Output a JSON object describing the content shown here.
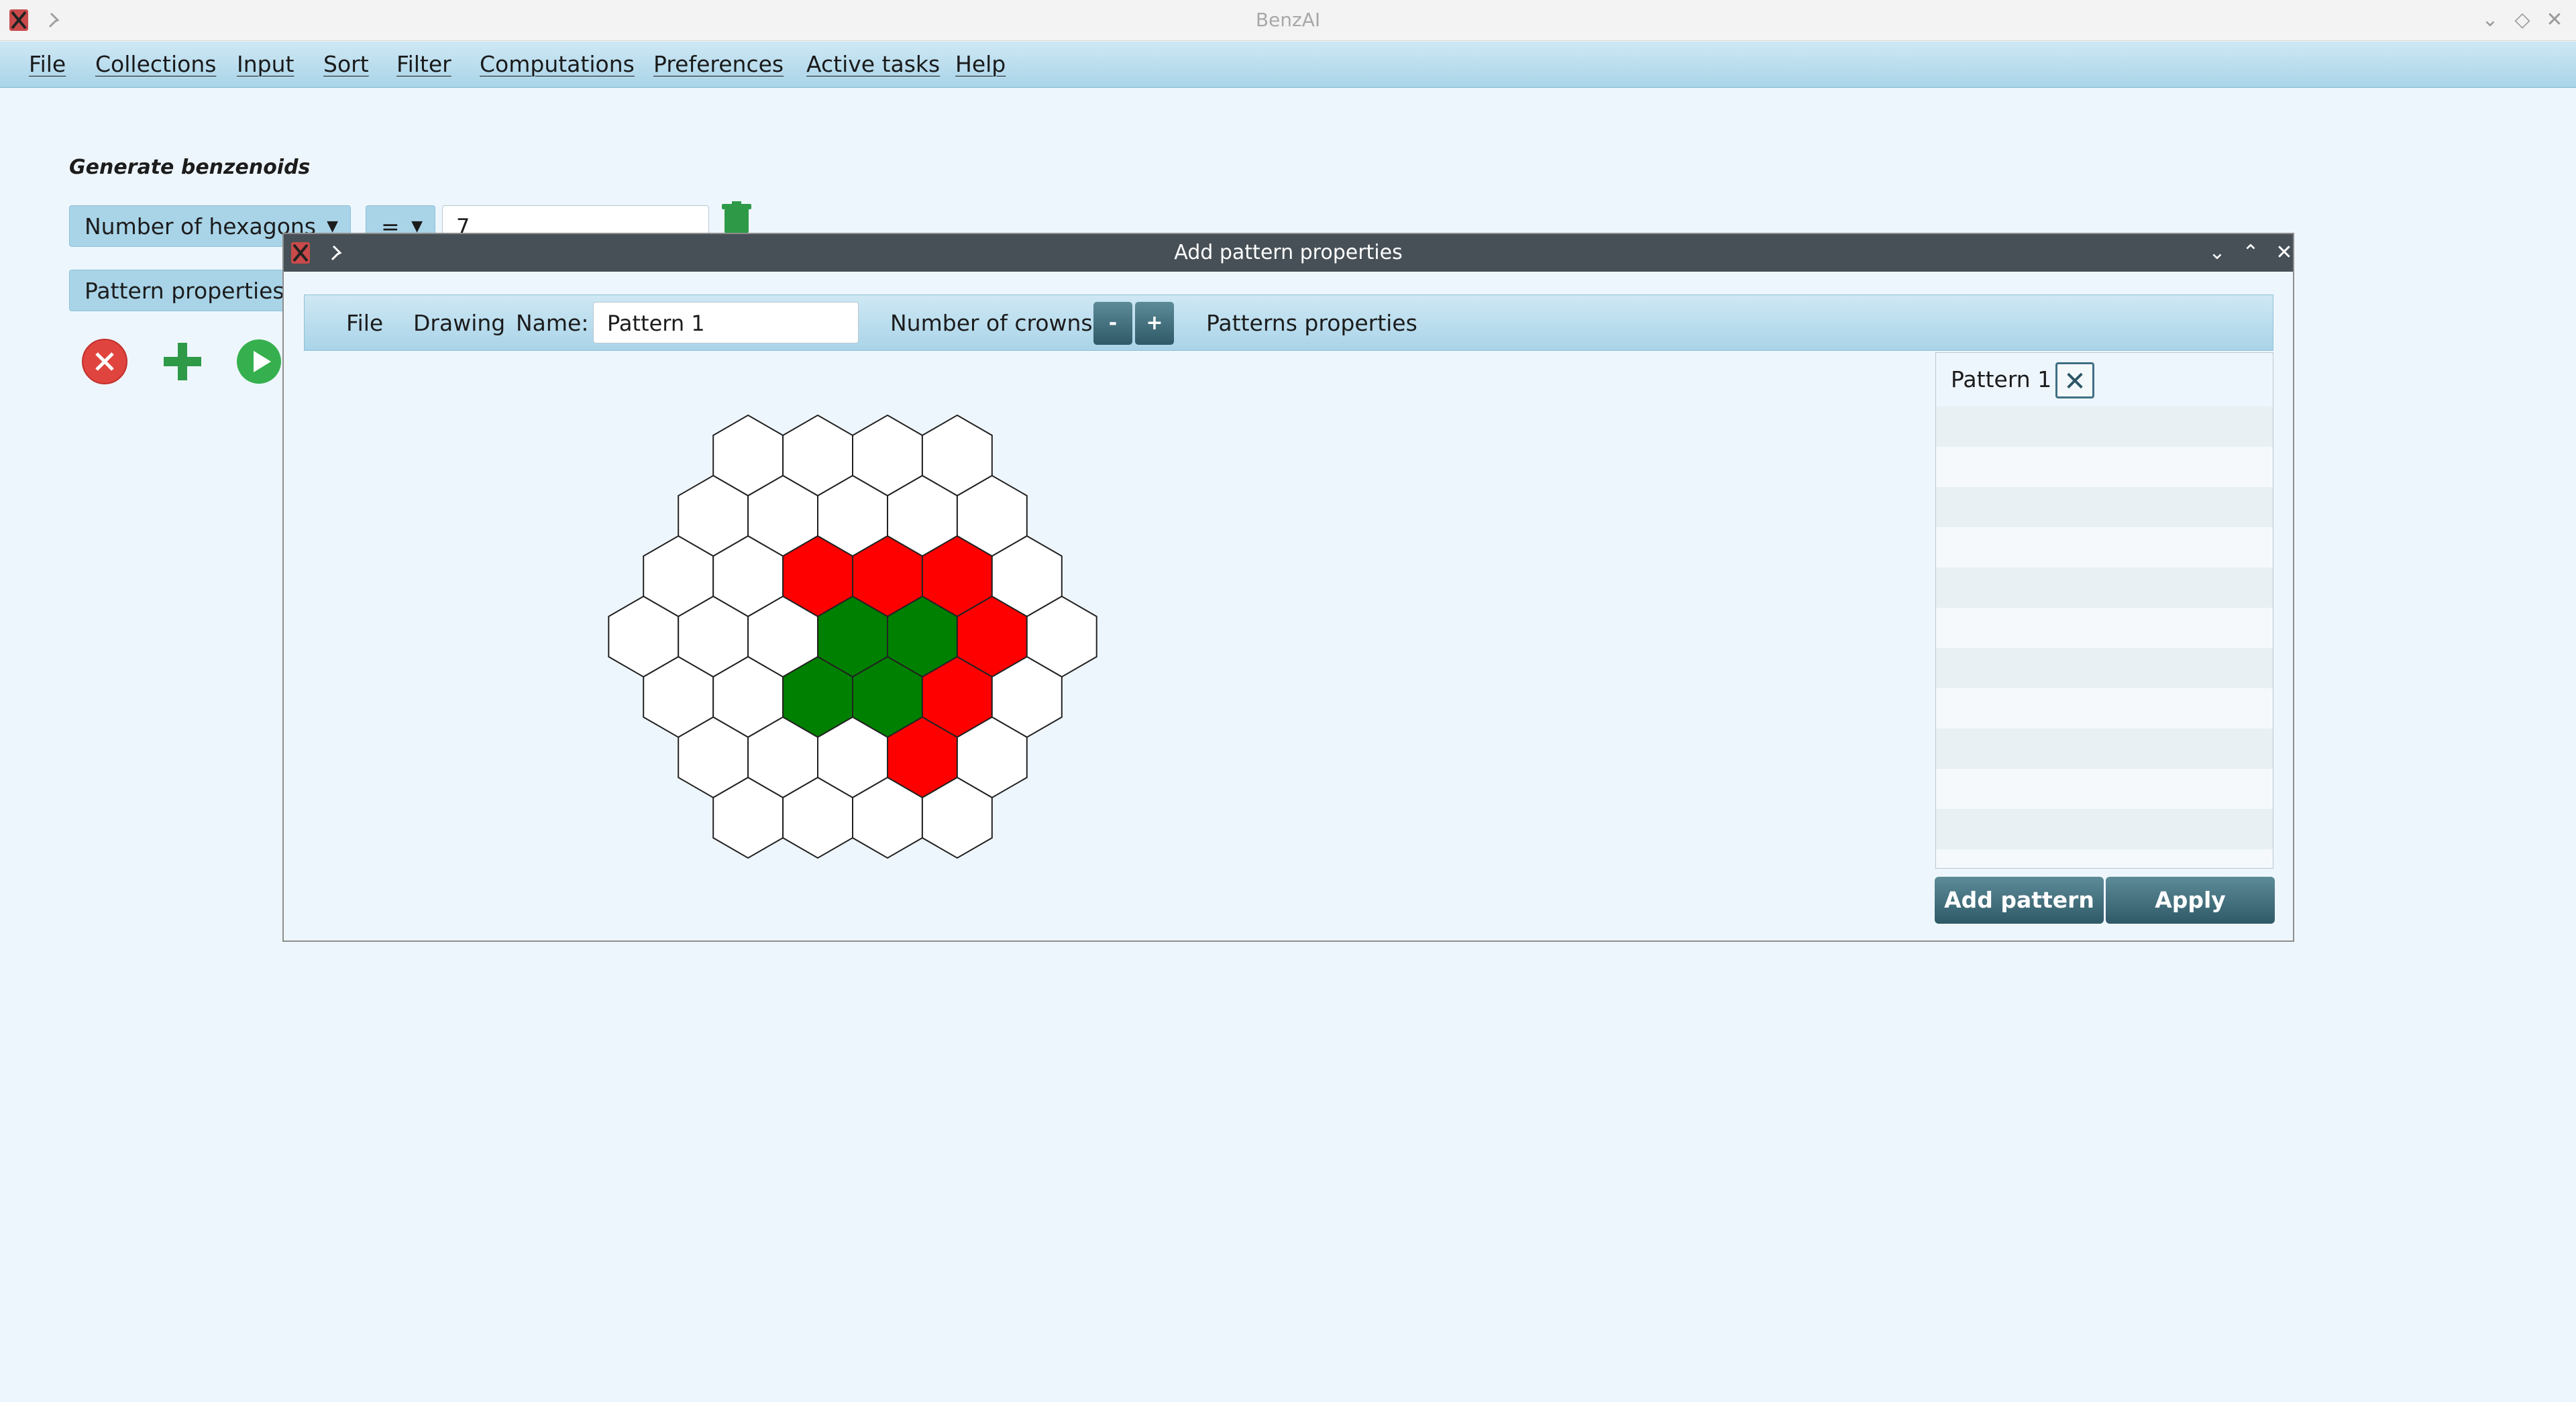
{
  "app": {
    "title": "BenzAI"
  },
  "menu": [
    "File",
    "Collections",
    "Input",
    "Sort",
    "Filter",
    "Computations",
    "Preferences",
    "Active tasks",
    "Help"
  ],
  "main": {
    "section_title": "Generate benzenoids",
    "criterion_select": "Number of hexagons",
    "operator_select": "=",
    "value_input": "7",
    "pattern_props_select": "Pattern properties"
  },
  "dialog": {
    "title": "Add pattern properties",
    "toolbar": {
      "file": "File",
      "drawing": "Drawing",
      "name_label": "Name:",
      "name_value": "Pattern 1",
      "crowns_label": "Number of crowns:",
      "minus": "-",
      "plus": "+",
      "patterns_properties": "Patterns properties"
    },
    "pattern_list": {
      "items": [
        "Pattern 1"
      ]
    },
    "add_pattern_button": "Add pattern",
    "apply_button": "Apply"
  },
  "colors": {
    "red": "#ff0000",
    "green": "#008000",
    "empty": "#ffffff",
    "accent": "#a9d4e8",
    "button": "#2f5967"
  },
  "hex_grid": {
    "crowns": 3,
    "rows": [
      [
        "empty",
        "empty",
        "empty",
        "empty"
      ],
      [
        "empty",
        "empty",
        "empty",
        "empty",
        "empty"
      ],
      [
        "empty",
        "empty",
        "red",
        "red",
        "red",
        "empty"
      ],
      [
        "empty",
        "empty",
        "empty",
        "green",
        "green",
        "red",
        "empty"
      ],
      [
        "empty",
        "empty",
        "green",
        "green",
        "red",
        "empty"
      ],
      [
        "empty",
        "empty",
        "empty",
        "red",
        "empty"
      ],
      [
        "empty",
        "empty",
        "empty",
        "empty"
      ]
    ]
  }
}
